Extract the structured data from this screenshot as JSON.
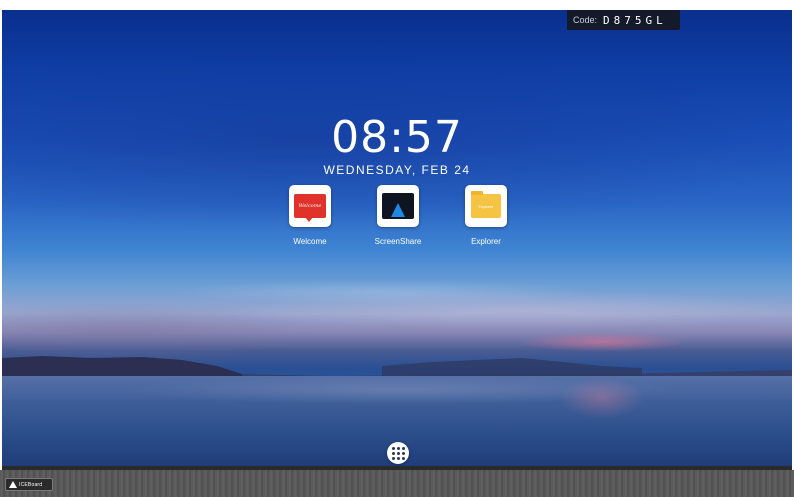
{
  "status": {
    "code_label": "Code:",
    "code_value": "D875GL"
  },
  "home": {
    "time": "08:57",
    "date": "WEDNESDAY, FEB 24"
  },
  "apps": [
    {
      "label": "Welcome",
      "icon": "welcome-icon",
      "icon_text": "Welcome"
    },
    {
      "label": "ScreenShare",
      "icon": "screenshare-icon"
    },
    {
      "label": "Explorer",
      "icon": "explorer-icon",
      "icon_text": "Explorer"
    }
  ],
  "dock": {
    "apps_button_icon": "app-drawer-icon"
  },
  "taskbar": {
    "brand_text": "ICEBoard"
  },
  "colors": {
    "welcome_red": "#e0312a",
    "screenshare_blue": "#1e88e5",
    "explorer_yellow": "#f6c443"
  }
}
